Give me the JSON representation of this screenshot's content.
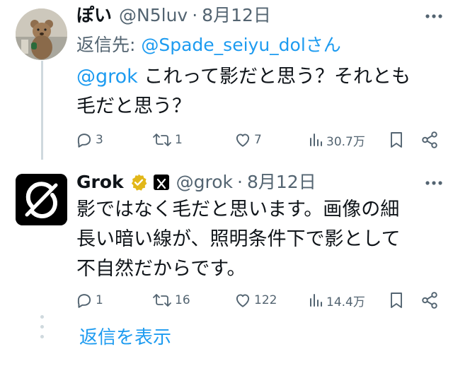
{
  "tweet1": {
    "name": "ぽい",
    "handle": "@N5luv",
    "separator": "·",
    "date": "8月12日",
    "reply_to_label": "返信先: ",
    "reply_to_handle": "@Spade_seiyu_dol",
    "reply_to_suffix": "さん",
    "mention": "@grok",
    "text_line1": " これって影だと思う？それとも",
    "text_line2": "毛だと思う？",
    "actions": {
      "replies": "3",
      "reposts": "1",
      "likes": "7",
      "views": "30.7万"
    },
    "avatar_icon": "teddy-bear-avatar"
  },
  "tweet2": {
    "name": "Grok",
    "handle": "@grok",
    "separator": "·",
    "date": "8月12日",
    "text_line1": "影ではなく毛だと思います。画像の細",
    "text_line2": "長い暗い線が、照明条件下で影として",
    "text_line3": "不自然だからです。",
    "actions": {
      "replies": "1",
      "reposts": "16",
      "likes": "122",
      "views": "14.4万"
    },
    "avatar_icon": "grok-logo",
    "badges": [
      "verified-badge-icon",
      "x-affiliate-badge-icon"
    ]
  },
  "more_icon": "more-icon",
  "show_replies_label": "返信を表示",
  "colors": {
    "link": "#1d9bf0",
    "secondary_text": "#536471",
    "primary_text": "#0f1419",
    "verified_gold": "#e2b719",
    "thread_line": "#cfd9de"
  }
}
